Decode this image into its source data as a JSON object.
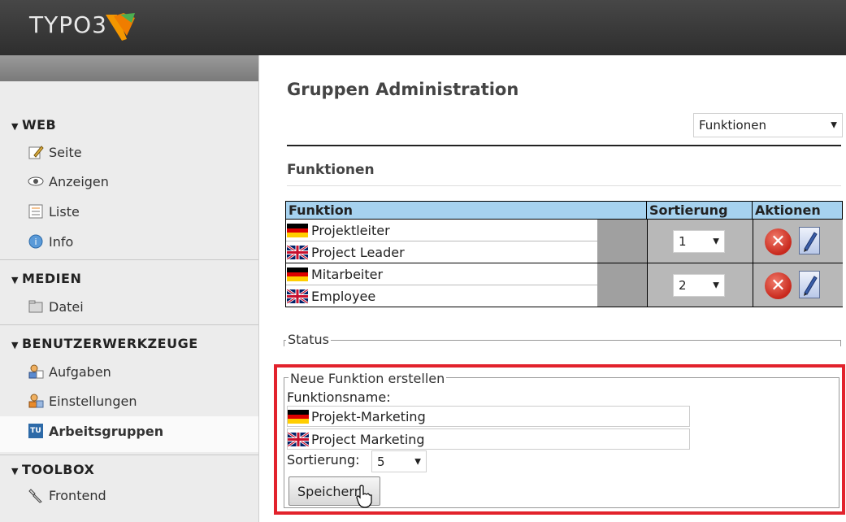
{
  "app": {
    "logo_text": "TYPO3"
  },
  "sidebar": {
    "groups": [
      {
        "label": "WEB",
        "items": [
          "Seite",
          "Anzeigen",
          "Liste",
          "Info"
        ]
      },
      {
        "label": "MEDIEN",
        "items": [
          "Datei"
        ]
      },
      {
        "label": "BENUTZERWERKZEUGE",
        "items": [
          "Aufgaben",
          "Einstellungen",
          "Arbeitsgruppen"
        ]
      },
      {
        "label": "TOOLBOX",
        "items": [
          "Frontend"
        ]
      }
    ],
    "active_item": "Arbeitsgruppen"
  },
  "main": {
    "title": "Gruppen Administration",
    "view_select": "Funktionen",
    "section_title": "Funktionen",
    "table": {
      "headers": [
        "Funktion",
        "Sortierung",
        "Aktionen"
      ],
      "rows": [
        {
          "de": "Projektleiter",
          "en": "Project Leader",
          "sort": "1"
        },
        {
          "de": "Mitarbeiter",
          "en": "Employee",
          "sort": "2"
        }
      ]
    },
    "status_legend": "Status",
    "new_function": {
      "legend": "Neue Funktion erstellen",
      "name_label": "Funktionsname:",
      "name_de": "Projekt-Marketing",
      "name_en": "Project Marketing",
      "sort_label": "Sortierung:",
      "sort_value": "5",
      "save_label": "Speichern"
    }
  },
  "colors": {
    "highlight": "#e2222c",
    "table_header": "#a6d2ef",
    "topbar": "#3a3a3a"
  }
}
